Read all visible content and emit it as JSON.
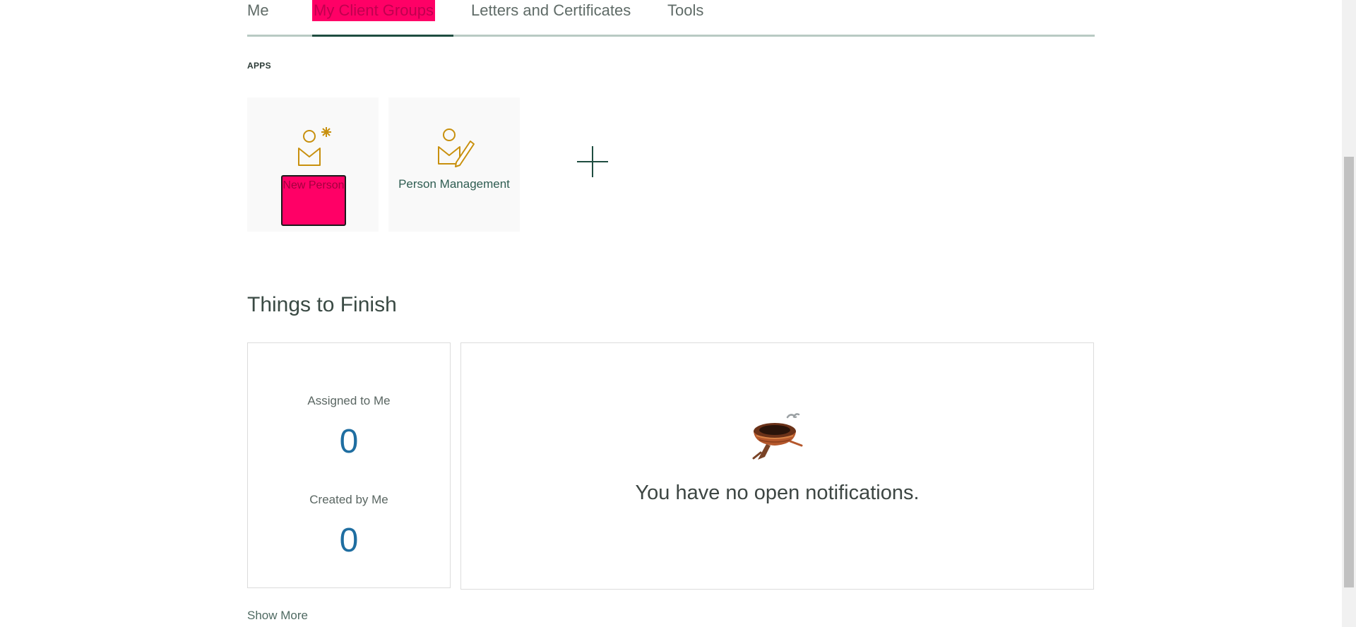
{
  "tabs": {
    "me": "Me",
    "client_groups": "My Client Groups",
    "letters": "Letters and Certificates",
    "tools": "Tools"
  },
  "apps": {
    "heading": "APPS",
    "items": [
      {
        "label": "New Person",
        "icon": "new-person-icon"
      },
      {
        "label": "Person Management",
        "icon": "person-management-icon"
      }
    ],
    "add_icon": "plus-icon"
  },
  "things_to_finish": {
    "title": "Things to Finish",
    "assigned_label": "Assigned to Me",
    "assigned_count": "0",
    "created_label": "Created by Me",
    "created_count": "0",
    "notifications_empty": "You have no open notifications.",
    "show_more": "Show More"
  },
  "colors": {
    "accent": "#1f4d40",
    "highlight": "#ff0066",
    "icon_gold": "#c8900e",
    "count_blue": "#1f6ea1"
  }
}
